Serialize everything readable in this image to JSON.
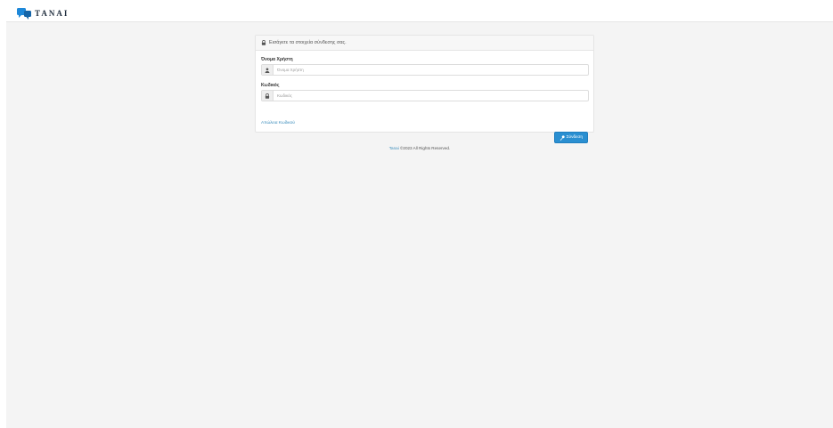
{
  "app": {
    "logo_text": "TANAI"
  },
  "login": {
    "heading": "Εισάγετε τα στοιχεία σύνδεσης σας.",
    "username_label": "Όνομα Χρήστη",
    "username_placeholder": "Όνομα Χρήστη",
    "username_value": "",
    "password_label": "Κωδικός",
    "password_placeholder": "Κωδικός",
    "password_value": "",
    "forgot_link": "Απώλεια Κωδικού",
    "submit_label": "Σύνδεση",
    "icons": {
      "heading": "lock-icon",
      "username": "user-icon",
      "password": "lock-icon",
      "submit": "key-icon"
    }
  },
  "footer": {
    "brand_link": "Tanai",
    "copyright": "©2023 All Rights Reserved."
  },
  "colors": {
    "primary_button": "#2a8fd1",
    "link": "#3c8dbc",
    "background": "#f4f4f4",
    "logo_blue": "#1e88d9"
  }
}
